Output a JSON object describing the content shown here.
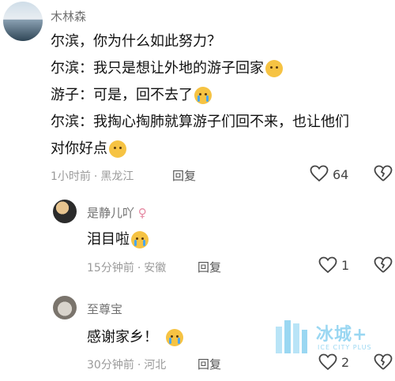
{
  "comment": {
    "author": "木林森",
    "lines": [
      "尔滨，你为什么如此努力？",
      "尔滨：我只是想让外地的游子回家",
      "游子：可是，回不去了",
      "尔滨：我掏心掏肺就算游子们回不来，也让他们",
      "对你好点"
    ],
    "time": "1小时前",
    "location": "黑龙江",
    "reply_label": "回复",
    "likes": "64"
  },
  "replies": [
    {
      "author": "是静儿吖",
      "text": "泪目啦",
      "time": "15分钟前",
      "location": "安徽",
      "reply_label": "回复",
      "likes": "1"
    },
    {
      "author": "至尊宝",
      "text": "感谢家乡！",
      "time": "30分钟前",
      "location": "河北",
      "reply_label": "回复",
      "likes": "2"
    }
  ],
  "watermark": {
    "text": "冰城+",
    "sub": "ICE CITY PLUS"
  },
  "icons": {
    "like": "heart-outline-icon",
    "dislike": "broken-heart-icon",
    "emoji_plead": "pleading-face-emoji",
    "emoji_cry": "crying-face-emoji"
  }
}
